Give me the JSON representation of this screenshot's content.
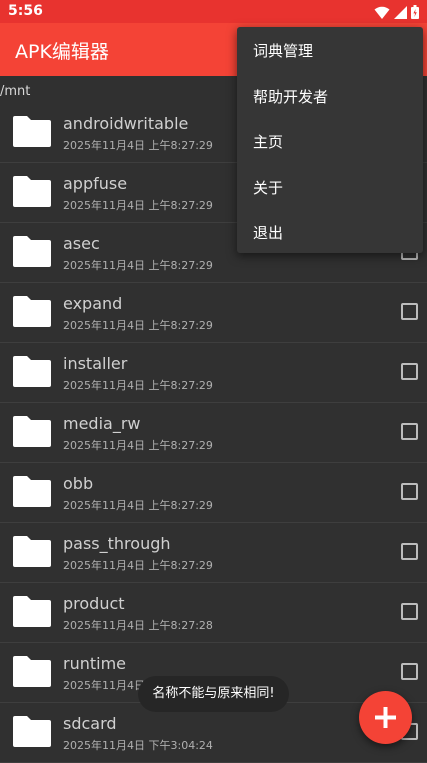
{
  "status_bar": {
    "time": "5:56",
    "icons": [
      "wifi-icon",
      "signal-icon",
      "battery-icon"
    ]
  },
  "app_bar": {
    "title": "APK编辑器"
  },
  "path": "/mnt",
  "files": [
    {
      "name": "androidwritable",
      "date": "2025年11月4日 上午8:27:29"
    },
    {
      "name": "appfuse",
      "date": "2025年11月4日 上午8:27:29"
    },
    {
      "name": "asec",
      "date": "2025年11月4日 上午8:27:29"
    },
    {
      "name": "expand",
      "date": "2025年11月4日 上午8:27:29"
    },
    {
      "name": "installer",
      "date": "2025年11月4日 上午8:27:29"
    },
    {
      "name": "media_rw",
      "date": "2025年11月4日 上午8:27:29"
    },
    {
      "name": "obb",
      "date": "2025年11月4日 上午8:27:29"
    },
    {
      "name": "pass_through",
      "date": "2025年11月4日 上午8:27:29"
    },
    {
      "name": "product",
      "date": "2025年11月4日 上午8:27:28"
    },
    {
      "name": "runtime",
      "date": "2025年11月4日"
    },
    {
      "name": "sdcard",
      "date": "2025年11月4日 下午3:04:24"
    }
  ],
  "menu": {
    "items": [
      "词典管理",
      "帮助开发者",
      "主页",
      "关于",
      "退出"
    ]
  },
  "toast": "名称不能与原来相同!",
  "fab": {
    "icon": "plus-icon"
  },
  "colors": {
    "primary": "#f44336",
    "status_bar": "#e8332f",
    "background": "#303030",
    "menu_background": "#363636"
  }
}
